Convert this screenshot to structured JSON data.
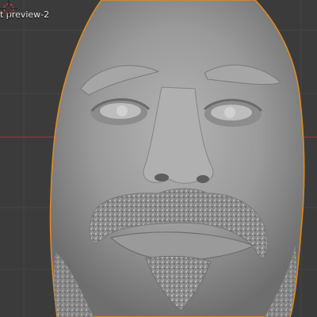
{
  "viewport": {
    "object_label": "t preview-2",
    "background_color": "#3b3b3b",
    "grid_color": "#454545",
    "axis_red_color": "#8a3a3a",
    "axis_green_color": "#6a8a3a",
    "mesh_color": "#9c9c9c",
    "outline_color": "#e08a1e"
  },
  "icons": {
    "cursor": "3d-cursor-icon"
  }
}
